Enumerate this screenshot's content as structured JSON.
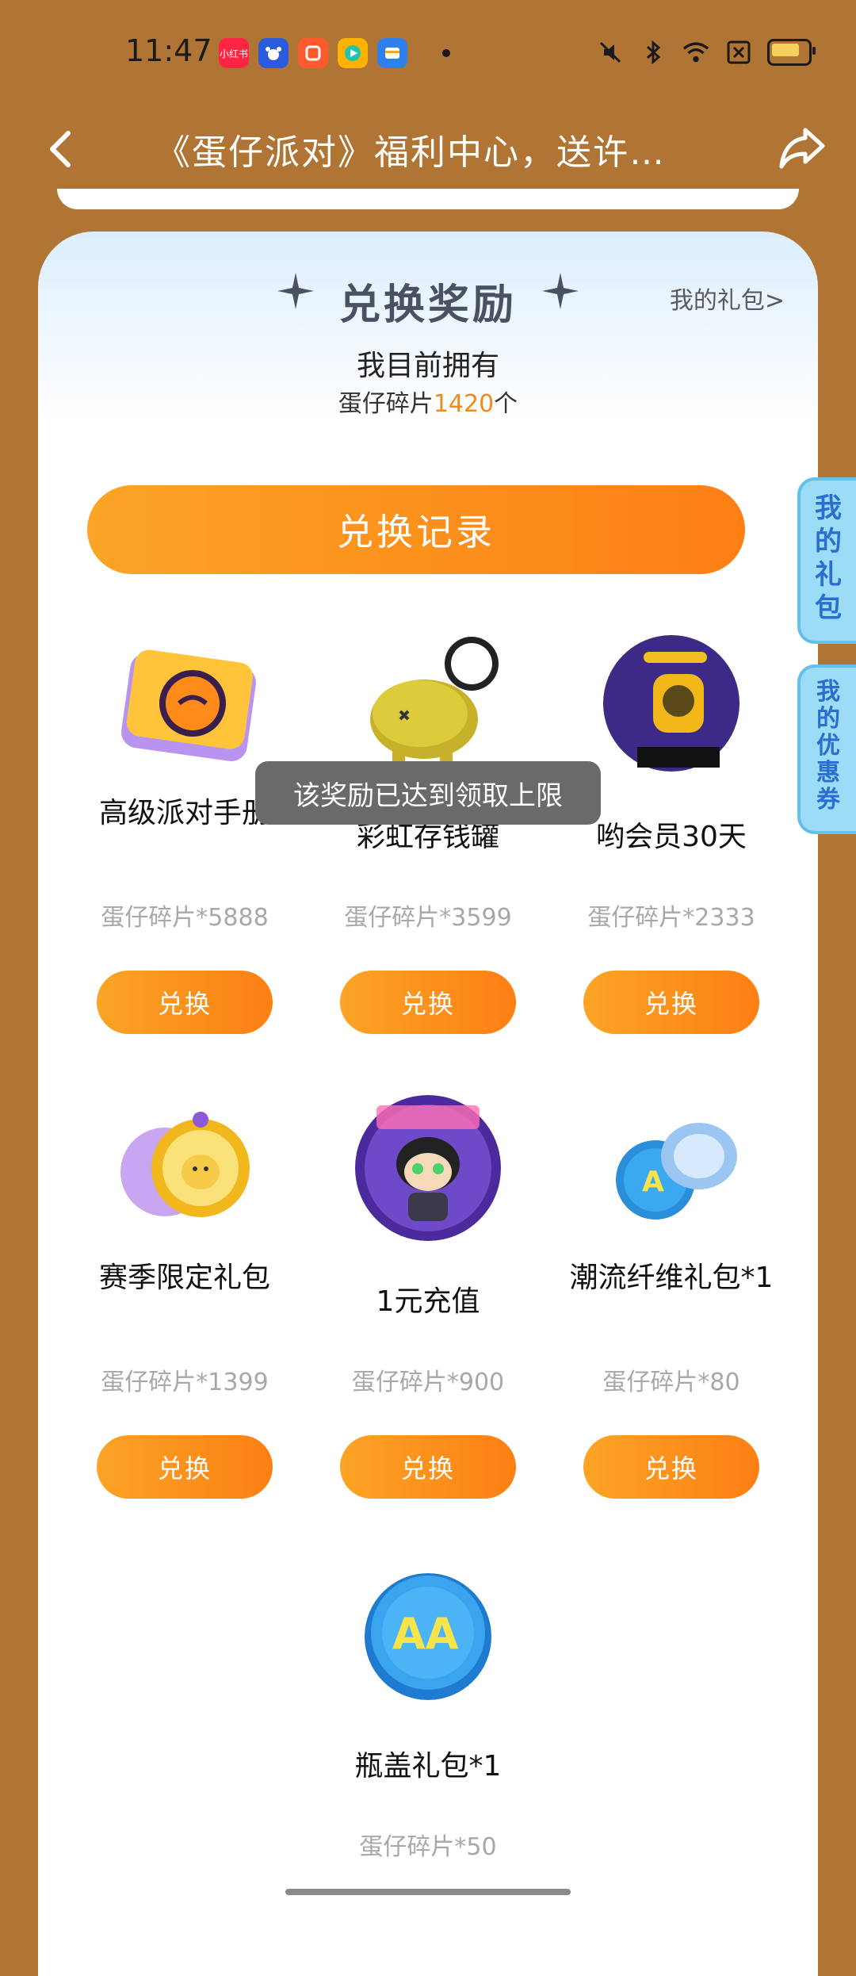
{
  "status_bar": {
    "time": "11:47",
    "apps": [
      {
        "icon": "xiaohongshu-icon",
        "label": "小红书",
        "color": "#ff2442"
      },
      {
        "icon": "baidu-icon",
        "label": "",
        "color": "#2a5bdc"
      },
      {
        "icon": "shop-icon",
        "label": "",
        "color": "#ff5a2c"
      },
      {
        "icon": "video-icon",
        "label": "",
        "color": "#ffb300"
      },
      {
        "icon": "wallet-icon",
        "label": "",
        "color": "#2f80ed"
      }
    ]
  },
  "header": {
    "title": "《蛋仔派对》福利中心，送许…"
  },
  "card": {
    "title": "兑换奖励",
    "my_gift_link": "我的礼包>",
    "own_label": "我目前拥有",
    "own_prefix": "蛋仔碎片",
    "own_amount": "1420",
    "own_suffix": "个",
    "record_button": "兑换记录"
  },
  "items": [
    {
      "name": "高级派对手册",
      "price": "蛋仔碎片*5888",
      "button": "兑换"
    },
    {
      "name": "彩虹存钱罐",
      "price": "蛋仔碎片*3599",
      "button": "兑换"
    },
    {
      "name": "哟会员30天",
      "price": "蛋仔碎片*2333",
      "button": "兑换"
    },
    {
      "name": "赛季限定礼包",
      "price": "蛋仔碎片*1399",
      "button": "兑换"
    },
    {
      "name": "1元充值",
      "price": "蛋仔碎片*900",
      "button": "兑换"
    },
    {
      "name": "潮流纤维礼包*1",
      "price": "蛋仔碎片*80",
      "button": "兑换"
    },
    {
      "name": "瓶盖礼包*1",
      "price": "蛋仔碎片*50",
      "button": "兑换"
    }
  ],
  "toast": "该奖励已达到领取上限",
  "side_tabs": [
    "我的礼包",
    "我的优惠券"
  ],
  "colors": {
    "background": "#b07434",
    "accent": "#fd8a18",
    "side_tab": "#9cdcf6"
  }
}
